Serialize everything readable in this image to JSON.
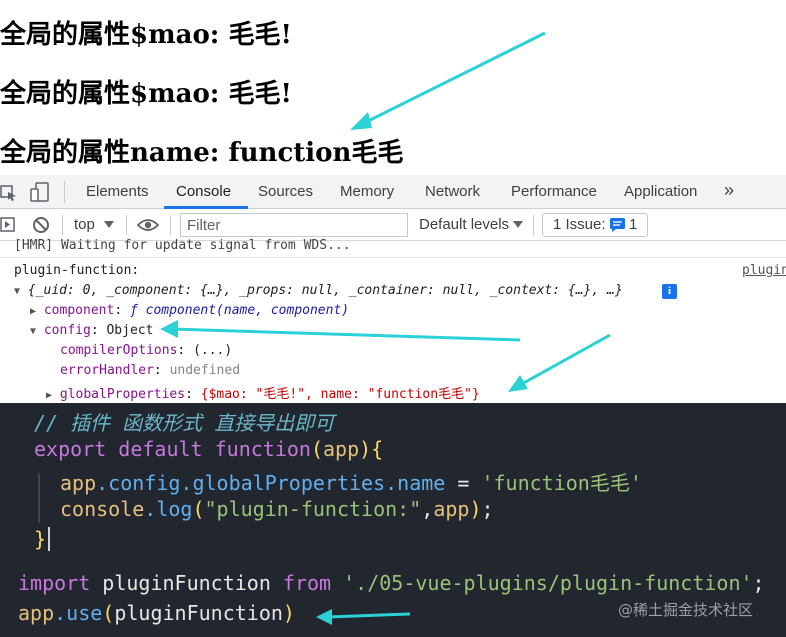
{
  "page": {
    "line1": "全局的属性$mao: 毛毛!",
    "line2": "全局的属性$mao: 毛毛!",
    "line3": "全局的属性name: function毛毛"
  },
  "devtools": {
    "tabs": [
      "Elements",
      "Console",
      "Sources",
      "Memory",
      "Network",
      "Performance",
      "Application"
    ],
    "active_tab": "Console",
    "more_tabs": "»",
    "toolbar": {
      "context": "top",
      "filter_placeholder": "Filter",
      "levels": "Default levels",
      "issues_label": "1 Issue:",
      "issues_count": "1"
    },
    "console": {
      "hmr_line": "[HMR] Waiting for update signal from WDS...",
      "log_label": "plugin-function:",
      "source_link": "plugin",
      "object_summary": "{_uid: 0, _component: {…}, _props: null, _container: null, _context: {…}, …}",
      "info_badge": "i",
      "component_key": "component",
      "component_val": "ƒ component(name, component)",
      "config_key": "config",
      "config_val": "Object",
      "compiler_key": "compilerOptions",
      "compiler_val": "(...)",
      "error_key": "errorHandler",
      "error_val": "undefined",
      "global_key": "globalProperties",
      "global_val": "{$mao: \"毛毛!\", name: \"function毛毛\"}"
    }
  },
  "editor": {
    "comment": "// 插件 函数形式 直接导出即可",
    "export_kw": "export default function",
    "app_param": "app",
    "config_line_obj": "app",
    "config_line_path": ".config.globalProperties.name",
    "config_line_eq": " = ",
    "config_line_str": "'function毛毛'",
    "console_obj": "console",
    "console_fn": ".log",
    "console_str": "\"plugin-function:\"",
    "console_arg": "app",
    "close_brace": "}",
    "import_kw": "import",
    "import_name": " pluginFunction ",
    "from_kw": "from",
    "import_path": "'./05-vue-plugins/plugin-function'",
    "import_semi": ";",
    "use_obj": "app",
    "use_fn": ".use",
    "use_arg": "pluginFunction"
  },
  "watermark": "@稀土掘金技术社区",
  "colors": {
    "accent_arrow": "#2ad1d6",
    "editor_bg": "#22262e",
    "tab_underline": "#1a73e8"
  }
}
